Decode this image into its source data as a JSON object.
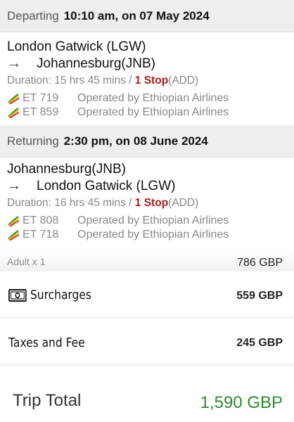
{
  "departing": {
    "label": "Departing",
    "datetime": "10:10 am, on 07 May 2024",
    "origin": "London Gatwick (LGW)",
    "destination": "Johannesburg(JNB)",
    "duration_text": "Duration: 15 hrs 45 mins /",
    "stops": "1 Stop",
    "stop_code": "(ADD)",
    "flights": [
      {
        "number": "ET 719",
        "operator": "Operated by Ethiopian Airlines"
      },
      {
        "number": "ET 859",
        "operator": "Operated by Ethiopian Airlines"
      }
    ]
  },
  "returning": {
    "label": "Returning",
    "datetime": "2:30 pm, on 08 June 2024",
    "origin": "Johannesburg(JNB)",
    "destination": "London Gatwick (LGW)",
    "duration_text": "Duration: 16 hrs 45 mins /",
    "stops": "1 Stop",
    "stop_code": "(ADD)",
    "flights": [
      {
        "number": "ET 808",
        "operator": "Operated by Ethiopian Airlines"
      },
      {
        "number": "ET 718",
        "operator": "Operated by Ethiopian Airlines"
      }
    ]
  },
  "pricing": {
    "adult_label": "Adult x 1",
    "adult_value": "786 GBP",
    "surcharges_label": "Surcharges",
    "surcharges_value": "559 GBP",
    "taxes_label": "Taxes and Fee",
    "taxes_value": "245 GBP",
    "total_label": "Trip Total",
    "total_value": "1,590 GBP"
  },
  "colors": {
    "stop": "#b01818",
    "total": "#2e8b2e",
    "header_bg": "#eeeeee"
  },
  "icons": {
    "arrow": "arrow-right-icon",
    "airline": "ethiopian-airlines-logo-icon",
    "cash": "cash-icon"
  }
}
